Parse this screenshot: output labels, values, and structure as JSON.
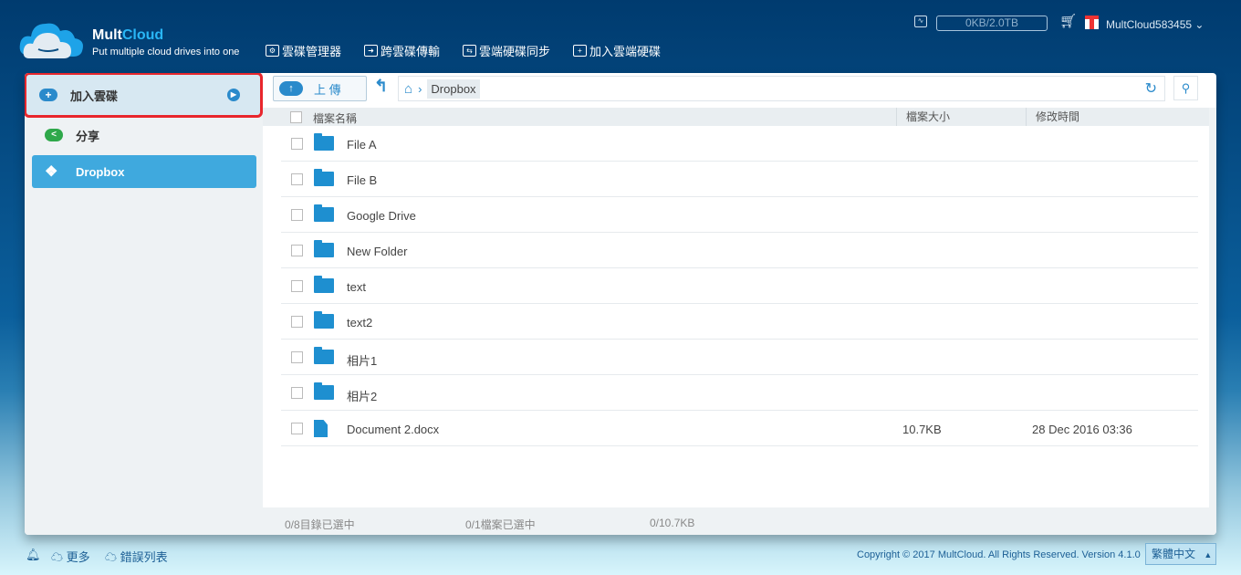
{
  "header": {
    "brand_a": "Mult",
    "brand_b": "Cloud",
    "tagline": "Put multiple cloud drives into one",
    "nav": [
      "雲碟管理器",
      "跨雲碟傳輸",
      "雲端硬碟同步",
      "加入雲端硬碟"
    ],
    "quota": "0KB/2.0TB",
    "user": "MultCloud583455"
  },
  "sidebar": {
    "items": [
      {
        "label": "加入雲碟"
      },
      {
        "label": "分享"
      },
      {
        "label": "Dropbox"
      }
    ]
  },
  "toolbar": {
    "upload": "上 傳",
    "breadcrumb": "Dropbox"
  },
  "table": {
    "headers": [
      "檔案名稱",
      "檔案大小",
      "修改時間"
    ],
    "rows": [
      {
        "name": "File A",
        "type": "folder",
        "size": "",
        "modified": ""
      },
      {
        "name": "File B",
        "type": "folder",
        "size": "",
        "modified": ""
      },
      {
        "name": "Google Drive",
        "type": "folder",
        "size": "",
        "modified": ""
      },
      {
        "name": "New Folder",
        "type": "folder",
        "size": "",
        "modified": ""
      },
      {
        "name": "text",
        "type": "folder",
        "size": "",
        "modified": ""
      },
      {
        "name": "text2",
        "type": "folder",
        "size": "",
        "modified": ""
      },
      {
        "name": "相片1",
        "type": "folder",
        "size": "",
        "modified": ""
      },
      {
        "name": "相片2",
        "type": "folder",
        "size": "",
        "modified": ""
      },
      {
        "name": "Document 2.docx",
        "type": "file",
        "size": "10.7KB",
        "modified": "28 Dec 2016 03:36"
      }
    ]
  },
  "status": {
    "dirs": "0/8目錄已選中",
    "files": "0/1檔案已選中",
    "size": "0/10.7KB"
  },
  "footer": {
    "more": "更多",
    "errors": "錯誤列表",
    "copyright": "Copyright © 2017 MultCloud. All Rights Reserved. Version 4.1.0",
    "language": "繁體中文"
  }
}
